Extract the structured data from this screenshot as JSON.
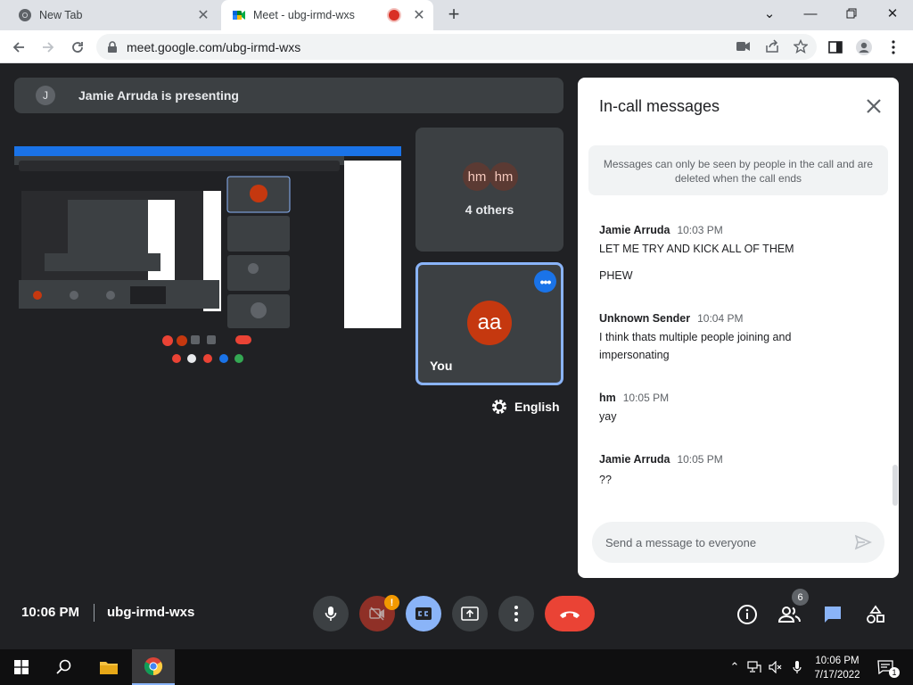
{
  "browser": {
    "tabs": [
      {
        "title": "New Tab",
        "active": false
      },
      {
        "title": "Meet - ubg-irmd-wxs",
        "active": true,
        "recording": true
      }
    ],
    "url": "meet.google.com/ubg-irmd-wxs",
    "icons": [
      "back-icon",
      "forward-icon",
      "reload-icon",
      "lock-icon",
      "camera-icon",
      "share-icon",
      "star-icon",
      "sidepanel-icon",
      "profile-icon",
      "menu-icon"
    ]
  },
  "meeting": {
    "presenting_banner": {
      "avatar_initial": "J",
      "text": "Jamie Arruda is presenting"
    },
    "tiles": {
      "others": {
        "avatar_1": "hm",
        "avatar_2": "hm",
        "label": "4 others"
      },
      "you": {
        "avatar": "aa",
        "label": "You",
        "more_label": "•••"
      }
    },
    "caption_language": "English",
    "time": "10:06 PM",
    "code": "ubg-irmd-wxs",
    "camera_warning": "!",
    "people_count": "6"
  },
  "chat": {
    "title": "In-call messages",
    "notice": "Messages can only be seen by people in the call and are deleted when the call ends",
    "messages": [
      {
        "sender": "Jamie Arruda",
        "time": "10:03 PM",
        "lines": [
          "LET ME TRY AND KICK ALL OF THEM",
          "PHEW"
        ]
      },
      {
        "sender": "Unknown Sender",
        "time": "10:04 PM",
        "lines": [
          "I think thats multiple people joining and",
          "impersonating"
        ]
      },
      {
        "sender": "hm",
        "time": "10:05 PM",
        "lines": [
          "yay"
        ]
      },
      {
        "sender": "Jamie Arruda",
        "time": "10:05 PM",
        "lines": [
          "??"
        ]
      }
    ],
    "input_placeholder": "Send a message to everyone"
  },
  "taskbar": {
    "time": "10:06 PM",
    "date": "7/17/2022",
    "notification_count": "1"
  },
  "colors": {
    "meet_bg": "#202124",
    "tile_bg": "#3c4043",
    "hangup_red": "#ea4335",
    "active_blue": "#8ab4f8",
    "self_avatar": "#c5380f"
  }
}
